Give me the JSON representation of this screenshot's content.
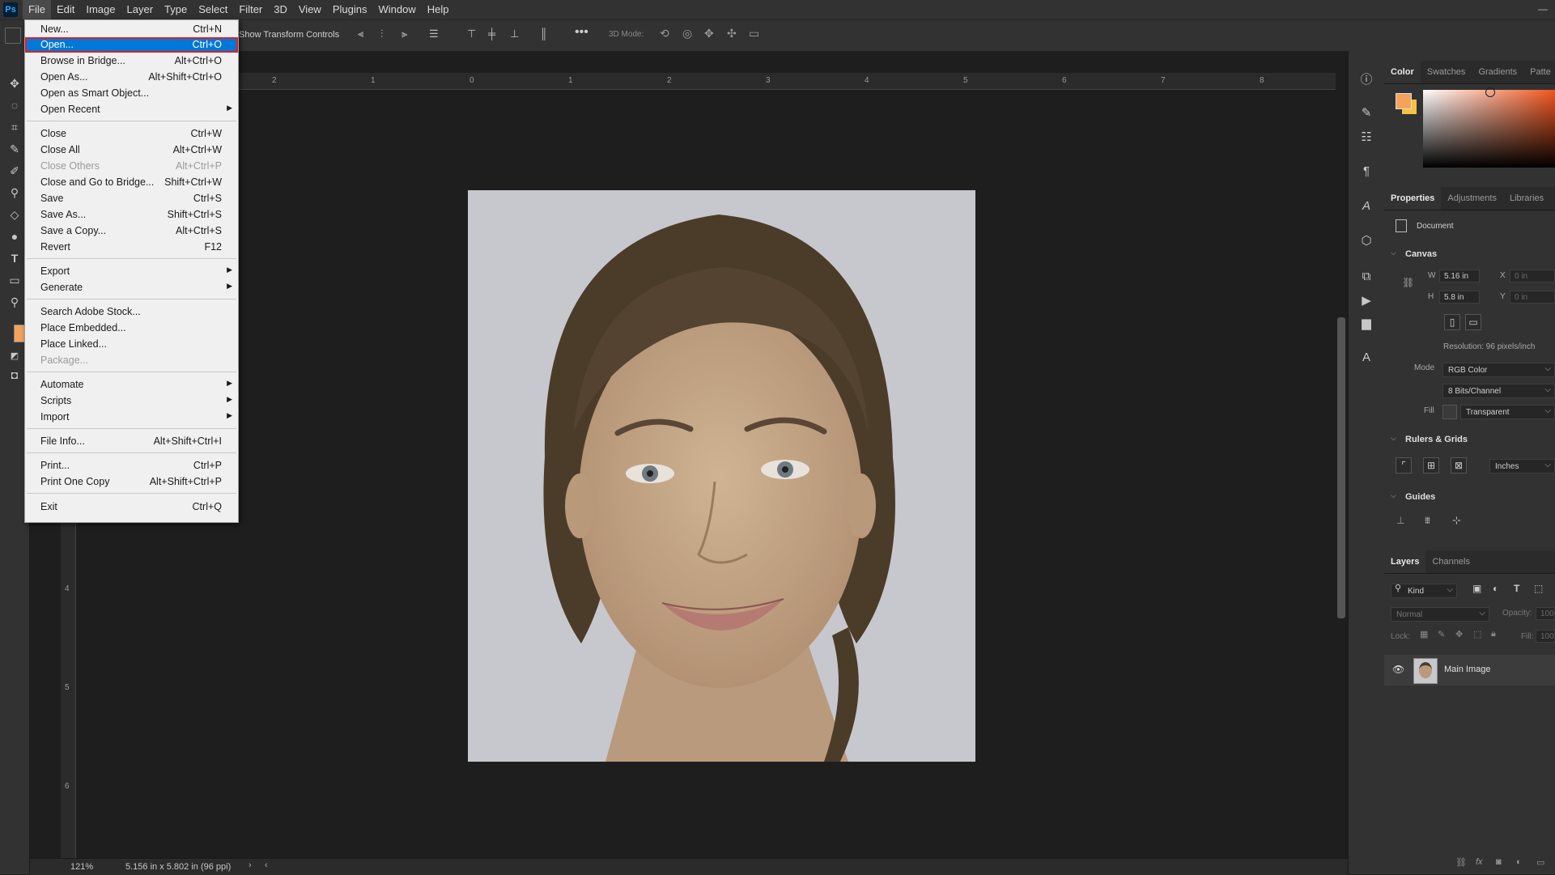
{
  "app": {
    "logo": "Ps"
  },
  "menubar": {
    "items": [
      "File",
      "Edit",
      "Image",
      "Layer",
      "Type",
      "Select",
      "Filter",
      "3D",
      "View",
      "Plugins",
      "Window",
      "Help"
    ]
  },
  "options": {
    "transform_label": "Show Transform Controls",
    "mode_3d_label": "3D Mode:"
  },
  "file_menu": {
    "items": [
      {
        "label": "New...",
        "shortcut": "Ctrl+N"
      },
      {
        "label": "Open...",
        "shortcut": "Ctrl+O",
        "highlighted": true
      },
      {
        "label": "Browse in Bridge...",
        "shortcut": "Alt+Ctrl+O"
      },
      {
        "label": "Open As...",
        "shortcut": "Alt+Shift+Ctrl+O"
      },
      {
        "label": "Open as Smart Object...",
        "shortcut": ""
      },
      {
        "label": "Open Recent",
        "shortcut": "",
        "submenu": true
      },
      {
        "label": "Close",
        "shortcut": "Ctrl+W"
      },
      {
        "label": "Close All",
        "shortcut": "Alt+Ctrl+W"
      },
      {
        "label": "Close Others",
        "shortcut": "Alt+Ctrl+P",
        "disabled": true
      },
      {
        "label": "Close and Go to Bridge...",
        "shortcut": "Shift+Ctrl+W"
      },
      {
        "label": "Save",
        "shortcut": "Ctrl+S"
      },
      {
        "label": "Save As...",
        "shortcut": "Shift+Ctrl+S"
      },
      {
        "label": "Save a Copy...",
        "shortcut": "Alt+Ctrl+S"
      },
      {
        "label": "Revert",
        "shortcut": "F12"
      },
      {
        "label": "Export",
        "shortcut": "",
        "submenu": true
      },
      {
        "label": "Generate",
        "shortcut": "",
        "submenu": true
      },
      {
        "label": "Search Adobe Stock...",
        "shortcut": ""
      },
      {
        "label": "Place Embedded...",
        "shortcut": ""
      },
      {
        "label": "Place Linked...",
        "shortcut": ""
      },
      {
        "label": "Package...",
        "shortcut": "",
        "disabled": true
      },
      {
        "label": "Automate",
        "shortcut": "",
        "submenu": true
      },
      {
        "label": "Scripts",
        "shortcut": "",
        "submenu": true
      },
      {
        "label": "Import",
        "shortcut": "",
        "submenu": true
      },
      {
        "label": "File Info...",
        "shortcut": "Alt+Shift+Ctrl+I"
      },
      {
        "label": "Print...",
        "shortcut": "Ctrl+P"
      },
      {
        "label": "Print One Copy",
        "shortcut": "Alt+Shift+Ctrl+P"
      },
      {
        "label": "Exit",
        "shortcut": "Ctrl+Q"
      }
    ]
  },
  "ruler": {
    "top_labels": [
      "2",
      "1",
      "0",
      "1",
      "2",
      "3",
      "4",
      "5",
      "6",
      "7",
      "8"
    ],
    "left_labels": [
      "4",
      "5",
      "6"
    ]
  },
  "status": {
    "zoom": "121%",
    "doc_size": "5.156 in x 5.802 in (96 ppi)"
  },
  "color_panel": {
    "tabs": [
      "Color",
      "Swatches",
      "Gradients",
      "Patte"
    ],
    "fg_color": "#f4a35c",
    "bg_color": "#f5c242"
  },
  "properties_panel": {
    "tabs": [
      "Properties",
      "Adjustments",
      "Libraries"
    ],
    "doc_label": "Document",
    "canvas_title": "Canvas",
    "w_label": "W",
    "w_value": "5.16 in",
    "h_label": "H",
    "h_value": "5.8 in",
    "x_label": "X",
    "x_value": "0 in",
    "y_label": "Y",
    "y_value": "0 in",
    "resolution": "Resolution: 96 pixels/inch",
    "mode_label": "Mode",
    "mode_value": "RGB Color",
    "bits_value": "8 Bits/Channel",
    "fill_label": "Fill",
    "fill_value": "Transparent",
    "rulers_title": "Rulers & Grids",
    "units_value": "Inches",
    "guides_title": "Guides"
  },
  "layers_panel": {
    "tabs": [
      "Layers",
      "Channels"
    ],
    "filter_label": "Kind",
    "blend_mode": "Normal",
    "opacity_label": "Opacity:",
    "opacity_value": "100",
    "lock_label": "Lock:",
    "fill_label": "Fill:",
    "fill_value": "100",
    "layers": [
      {
        "name": "Main Image",
        "visible": true
      }
    ]
  }
}
